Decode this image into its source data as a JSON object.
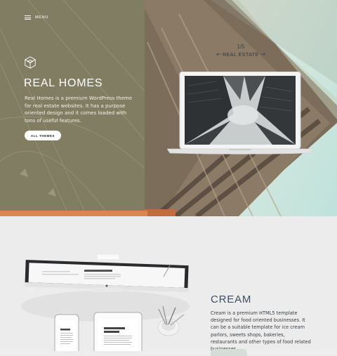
{
  "hero": {
    "menu_label": "MENU",
    "logo_icon": "cube-icon",
    "title": "REAL HOMES",
    "description": "Real Homes is a premium WordPress theme for real estate websites. It has a purpose oriented design and it comes loaded with tons of useful features.",
    "cta_label": "ALL THEMES",
    "panel_color": "#817e64"
  },
  "slider": {
    "counter": "1/5",
    "category": "REAL ESTATE",
    "prev_icon": "arrow-left-icon",
    "next_icon": "arrow-right-icon"
  },
  "section2": {
    "title": "CREAM",
    "description": "Cream is a premium HTML5 template designed for food oriented businesses. It can be a suitable template for ice cream parlors, sweets shops, bakeries, restaurants and other types of food related businesses.",
    "accent_color": "#3d4f60"
  }
}
